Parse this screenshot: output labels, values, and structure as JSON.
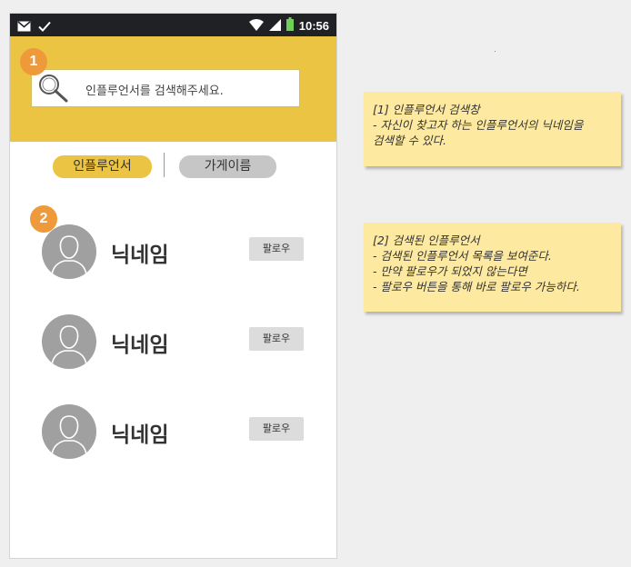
{
  "statusbar": {
    "time": "10:56",
    "left_icons": [
      "mail-icon",
      "check-icon"
    ],
    "right_icons": [
      "wifi-icon",
      "signal-icon",
      "battery-icon"
    ]
  },
  "search": {
    "placeholder": "인플루언서를 검색해주세요."
  },
  "badges": {
    "search_badge": "1",
    "list_badge": "2"
  },
  "tabs": [
    {
      "label": "인플루언서",
      "active": true
    },
    {
      "label": "가게이름",
      "active": false
    }
  ],
  "results": [
    {
      "nickname": "닉네임",
      "follow_label": "팔로우"
    },
    {
      "nickname": "닉네임",
      "follow_label": "팔로우"
    },
    {
      "nickname": "닉네임",
      "follow_label": "팔로우"
    }
  ],
  "notes": {
    "note1": {
      "lines": [
        "[1] 인플루언서 검색창",
        "- 자신이 찾고자 하는 인플루언서의 닉네임을",
        "검색할 수 있다."
      ]
    },
    "note2": {
      "lines": [
        "[2] 검색된 인플루언서",
        "- 검색된 인플루언서 목록을 보여준다.",
        "- 만약 팔로우가 되었지 않는다면",
        "- 팔로우 버튼을 통해 바로 팔로우 가능하다."
      ]
    }
  },
  "colors": {
    "header": "#ebc443",
    "badge": "#ee9a3a",
    "active_tab": "#ebc443",
    "inactive_tab": "#c6c6c6",
    "note_bg": "#fde99f",
    "statusbar": "#202124"
  }
}
